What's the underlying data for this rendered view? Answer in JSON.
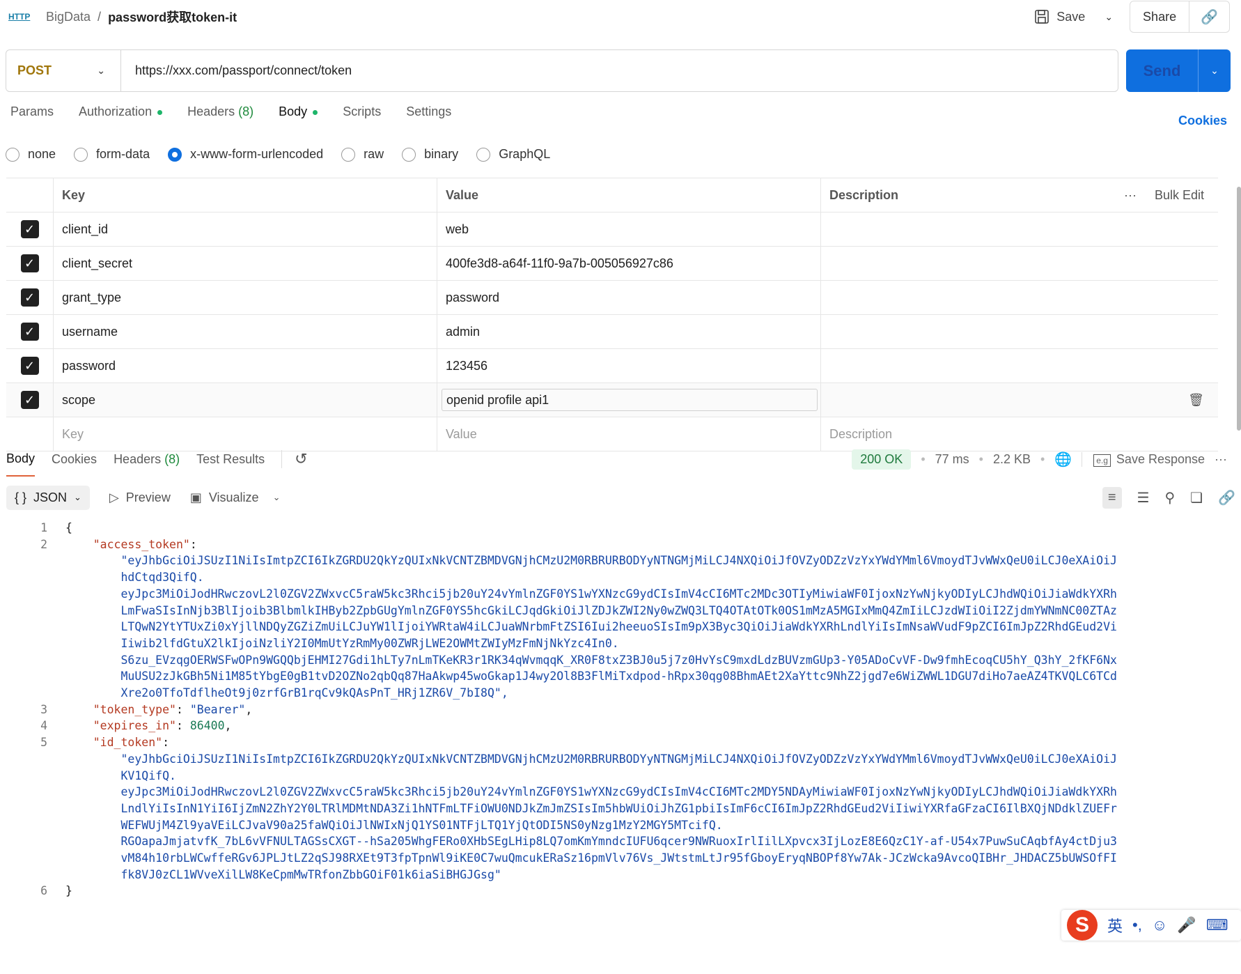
{
  "header": {
    "protocol": "HTTP",
    "collection": "BigData",
    "separator": "/",
    "request_name": "password获取token-it",
    "save": "Save",
    "share": "Share"
  },
  "request": {
    "method": "POST",
    "url": "https://xxx.com/passport/connect/token",
    "send": "Send"
  },
  "tabs": [
    {
      "label": "Params"
    },
    {
      "label": "Authorization"
    },
    {
      "label": "Headers",
      "count": "(8)"
    },
    {
      "label": "Body"
    },
    {
      "label": "Scripts"
    },
    {
      "label": "Settings"
    }
  ],
  "cookies": "Cookies",
  "body_types": [
    "none",
    "form-data",
    "x-www-form-urlencoded",
    "raw",
    "binary",
    "GraphQL"
  ],
  "table": {
    "headers": {
      "key": "Key",
      "value": "Value",
      "description": "Description",
      "bulk": "Bulk Edit"
    },
    "rows": [
      {
        "key": "client_id",
        "value": "web"
      },
      {
        "key": "client_secret",
        "value": "400fe3d8-a64f-11f0-9a7b-005056927c86"
      },
      {
        "key": "grant_type",
        "value": "password"
      },
      {
        "key": "username",
        "value": "admin"
      },
      {
        "key": "password",
        "value": "123456"
      },
      {
        "key": "scope",
        "value": "openid profile api1"
      }
    ],
    "placeholder": {
      "key": "Key",
      "value": "Value",
      "description": "Description"
    }
  },
  "response": {
    "tabs": [
      "Body",
      "Cookies",
      "Headers",
      "Test Results"
    ],
    "headers_count": "(8)",
    "status": "200 OK",
    "time": "77 ms",
    "size": "2.2 KB",
    "save_response": "Save Response",
    "format": "JSON",
    "preview": "Preview",
    "visualize": "Visualize"
  },
  "code_lines": [
    {
      "n": "1",
      "t": "{"
    },
    {
      "n": "2",
      "t": "    \"access_token\":"
    },
    {
      "n": "",
      "t": "        \"eyJhbGciOiJSUzI1NiIsImtpZCI6IkZGRDU2QkYzQUIxNkVCNTZBMDVGNjhCMzU2M0RBRURBODYyNTNGMjMiLCJ4NXQiOiJfOVZyODZzVzYxYWdYMml6VmoydTJvWWxQeU0iLCJ0eXAiOiJ"
    },
    {
      "n": "",
      "t": "        hdCtqd3QifQ."
    },
    {
      "n": "",
      "t": "        eyJpc3MiOiJodHRwczovL2l0ZGV2ZWxvcC5raW5kc3Rhci5jb20uY24vYmlnZGF0YS1wYXNzcG9ydCIsImV4cCI6MTc2MDc3OTIyMiwiaWF0IjoxNzYwNjkyODIyLCJhdWQiOiJiaWdkYXRh"
    },
    {
      "n": "",
      "t": "        LmFwaSIsInNjb3BlIjoib3BlbmlkIHByb2ZpbGUgYmlnZGF0YS5hcGkiLCJqdGkiOiJlZDJkZWI2Ny0wZWQ3LTQ4OTAtOTk0OS1mMzA5MGIxMmQ4ZmIiLCJzdWIiOiI2ZjdmYWNmNC00ZTAz"
    },
    {
      "n": "",
      "t": "        LTQwN2YtYTUxZi0xYjllNDQyZGZiZmUiLCJuYW1lIjoiYWRtaW4iLCJuaWNrbmFtZSI6Iui2heeuoSIsIm9pX3Byc3QiOiJiaWdkYXRhLndlYiIsImNsaWVudF9pZCI6ImJpZ2RhdGEud2Vi"
    },
    {
      "n": "",
      "t": "        Iiwib2lfdGtuX2lkIjoiNzliY2I0MmUtYzRmMy00ZWRjLWE2OWMtZWIyMzFmNjNkYzc4In0."
    },
    {
      "n": "",
      "t": "        S6zu_EVzqgOERWSFwOPn9WGQQbjEHMI27Gdi1hLTy7nLmTKeKR3r1RK34qWvmqqK_XR0F8txZ3BJ0u5j7z0HvYsC9mxdLdzBUVzmGUp3-Y05ADoCvVF-Dw9fmhEcoqCU5hY_Q3hY_2fKF6Nx"
    },
    {
      "n": "",
      "t": "        MuUSU2zJkGBh5Ni1M85tYbgE0gB1tvD2OZNo2qbQq87HaAkwp45woGkap1J4wy2Ol8B3FlMiTxdpod-hRpx30qg08BhmAEt2XaYttc9NhZ2jgd7e6WiZWWL1DGU7diHo7aeAZ4TKVQLC6TCd"
    },
    {
      "n": "",
      "t": "        Xre2o0TfoTdflheOt9j0zrfGrB1rqCv9kQAsPnT_HRj1ZR6V_7bI8Q\","
    },
    {
      "n": "3",
      "t": "    \"token_type\": \"Bearer\","
    },
    {
      "n": "4",
      "t": "    \"expires_in\": 86400,"
    },
    {
      "n": "5",
      "t": "    \"id_token\":"
    },
    {
      "n": "",
      "t": "        \"eyJhbGciOiJSUzI1NiIsImtpZCI6IkZGRDU2QkYzQUIxNkVCNTZBMDVGNjhCMzU2M0RBRURBODYyNTNGMjMiLCJ4NXQiOiJfOVZyODZzVzYxYWdYMml6VmoydTJvWWxQeU0iLCJ0eXAiOiJ"
    },
    {
      "n": "",
      "t": "        KV1QifQ."
    },
    {
      "n": "",
      "t": "        eyJpc3MiOiJodHRwczovL2l0ZGV2ZWxvcC5raW5kc3Rhci5jb20uY24vYmlnZGF0YS1wYXNzcG9ydCIsImV4cCI6MTc2MDY5NDAyMiwiaWF0IjoxNzYwNjkyODIyLCJhdWQiOiJiaWdkYXRh"
    },
    {
      "n": "",
      "t": "        LndlYiIsInN1YiI6IjZmN2ZhY2Y0LTRlMDMtNDA3Zi1hNTFmLTFiOWU0NDJkZmJmZSIsIm5hbWUiOiJhZG1pbiIsImF6cCI6ImJpZ2RhdGEud2ViIiwiYXRfaGFzaCI6IlBXQjNDdklZUEFr"
    },
    {
      "n": "",
      "t": "        WEFWUjM4Zl9yaVEiLCJvaV90a25faWQiOiJlNWIxNjQ1YS01NTFjLTQ1YjQtODI5NS0yNzg1MzY2MGY5MTcifQ."
    },
    {
      "n": "",
      "t": "        RGOapaJmjatvfK_7bL6vVFNULTAGSsCXGT--hSa205WhgFERo0XHbSEgLHip8LQ7omKmYmndcIUFU6qcer9NWRuoxIrlIilLXpvcx3IjLozE8E6QzC1Y-af-U54x7PuwSuCAqbfAy4ctDju3"
    },
    {
      "n": "",
      "t": "        vM84h10rbLWCwffeRGv6JPLJtLZ2qSJ98RXEt9T3fpTpnWl9iKE0C7wuQmcukERaSz16pmVlv76Vs_JWtstmLtJr95fGboyEryqNBOPf8Yw7Ak-JCzWcka9AvcoQIBHr_JHDACZ5bUWSOfFI"
    },
    {
      "n": "",
      "t": "        fk8VJ0zCL1WVveXilLW8KeCpmMwTRfonZbbGOiF01k6iaSiBHGJGsg\""
    },
    {
      "n": "6",
      "t": "}"
    }
  ],
  "ime": {
    "mode": "英"
  },
  "colors": {
    "accent": "#0f6fdf",
    "method": "#a0760b",
    "status": "#1f7a3d"
  }
}
